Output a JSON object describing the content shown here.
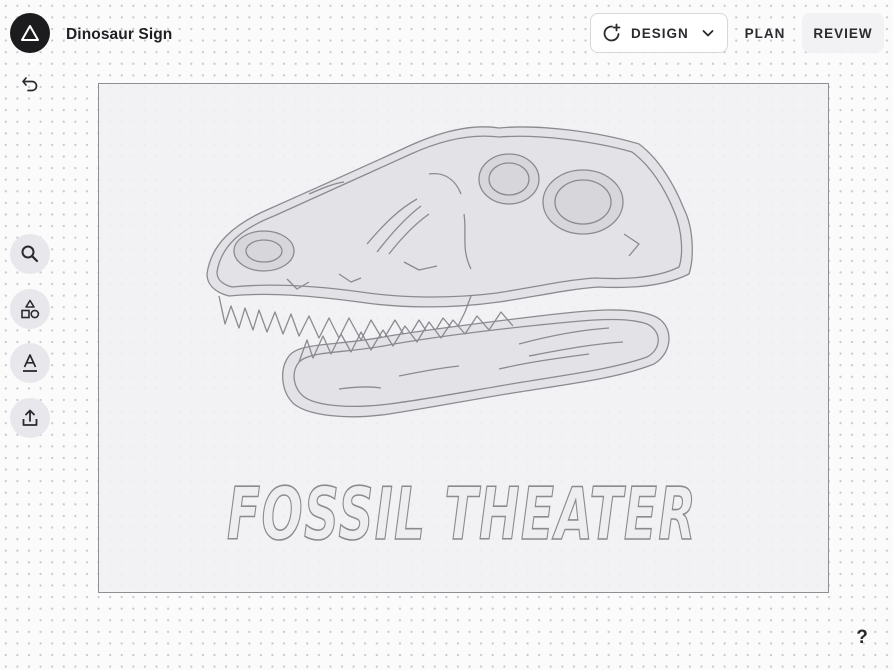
{
  "app": {
    "logo_icon": "triangle-logo-icon",
    "document_title": "Dinosaur Sign"
  },
  "nav": {
    "design_label": "DESIGN",
    "plan_label": "PLAN",
    "review_label": "REVIEW",
    "active_tab": "DESIGN"
  },
  "toolbar": {
    "undo_icon": "undo-icon",
    "tools": [
      {
        "id": "search",
        "icon": "search-icon"
      },
      {
        "id": "shapes",
        "icon": "shapes-icon"
      },
      {
        "id": "text",
        "icon": "text-icon"
      },
      {
        "id": "upload",
        "icon": "upload-icon"
      }
    ]
  },
  "canvas": {
    "sign_text": "FOSSIL THEATER",
    "artwork": "t-rex-skull-outline",
    "stroke_color": "#8a8a90",
    "fill_color": "#e6e6ea"
  },
  "help": {
    "label": "?"
  },
  "colors": {
    "accent": "#1c1c1e",
    "background": "#fbfbfc"
  }
}
